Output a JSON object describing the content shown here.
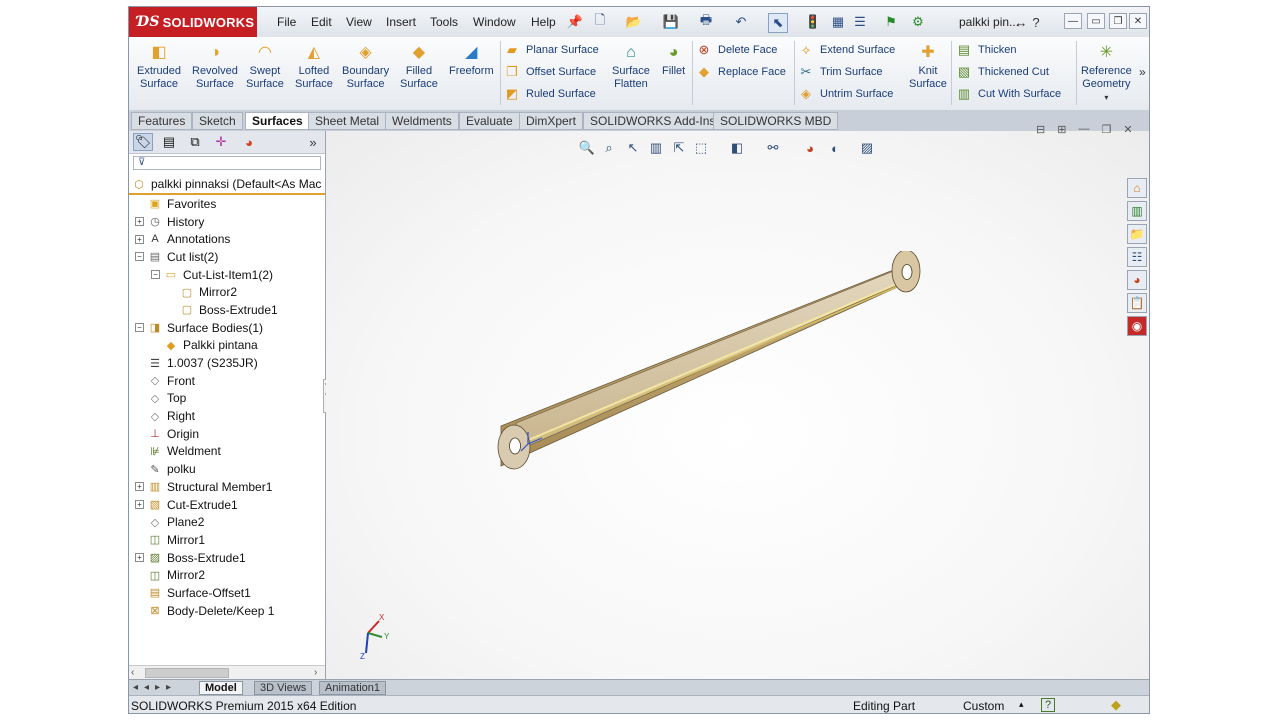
{
  "app": {
    "brand": "SOLIDWORKS",
    "document_title": "palkki pin...",
    "colors": {
      "brand_red": "#c51f24",
      "accent_orange": "#e0a030",
      "part_tan": "#d6bb86"
    }
  },
  "menu": [
    "File",
    "Edit",
    "View",
    "Insert",
    "Tools",
    "Window",
    "Help"
  ],
  "ribbon": {
    "large_buttons": [
      {
        "label_1": "Extruded",
        "label_2": "Surface",
        "icon": "extruded-surface-icon"
      },
      {
        "label_1": "Revolved",
        "label_2": "Surface",
        "icon": "revolved-surface-icon"
      },
      {
        "label_1": "Swept",
        "label_2": "Surface",
        "icon": "swept-surface-icon"
      },
      {
        "label_1": "Lofted",
        "label_2": "Surface",
        "icon": "lofted-surface-icon"
      },
      {
        "label_1": "Boundary",
        "label_2": "Surface",
        "icon": "boundary-surface-icon"
      },
      {
        "label_1": "Filled",
        "label_2": "Surface",
        "icon": "filled-surface-icon"
      },
      {
        "label_1": "Freeform",
        "label_2": "",
        "icon": "freeform-icon"
      }
    ],
    "col1": [
      "Planar Surface",
      "Offset Surface",
      "Ruled Surface"
    ],
    "surface_flatten": {
      "label_1": "Surface",
      "label_2": "Flatten"
    },
    "fillet": "Fillet",
    "col2": [
      "Delete Face",
      "Replace Face"
    ],
    "col3": [
      "Extend Surface",
      "Trim Surface",
      "Untrim Surface"
    ],
    "knit": {
      "label_1": "Knit",
      "label_2": "Surface"
    },
    "col4": [
      "Thicken",
      "Thickened Cut",
      "Cut With Surface"
    ],
    "reference_geometry": {
      "label_1": "Reference",
      "label_2": "Geometry"
    }
  },
  "tabs": [
    "Features",
    "Sketch",
    "Surfaces",
    "Sheet Metal",
    "Weldments",
    "Evaluate",
    "DimXpert",
    "SOLIDWORKS Add-Ins",
    "SOLIDWORKS MBD"
  ],
  "active_tab": "Surfaces",
  "tree": {
    "root": "palkki pinnaksi  (Default<As Mac",
    "items": [
      {
        "label": "Favorites",
        "expander": "",
        "indent": 0,
        "icon": "favorites-folder-icon"
      },
      {
        "label": "History",
        "expander": "+",
        "indent": 0,
        "icon": "history-icon"
      },
      {
        "label": "Annotations",
        "expander": "+",
        "indent": 0,
        "icon": "annotations-icon"
      },
      {
        "label": "Cut list(2)",
        "expander": "−",
        "indent": 0,
        "icon": "cut-list-icon"
      },
      {
        "label": "Cut-List-Item1(2)",
        "expander": "−",
        "indent": 1,
        "icon": "cut-list-item-folder-icon"
      },
      {
        "label": "Mirror2",
        "expander": "",
        "indent": 2,
        "icon": "solid-body-icon"
      },
      {
        "label": "Boss-Extrude1",
        "expander": "",
        "indent": 2,
        "icon": "solid-body-icon"
      },
      {
        "label": "Surface Bodies(1)",
        "expander": "−",
        "indent": 0,
        "icon": "surface-bodies-folder-icon"
      },
      {
        "label": "Palkki pintana",
        "expander": "",
        "indent": 1,
        "icon": "surface-body-icon"
      },
      {
        "label": "1.0037 (S235JR)",
        "expander": "",
        "indent": 0,
        "icon": "material-icon"
      },
      {
        "label": "Front",
        "expander": "",
        "indent": 0,
        "icon": "plane-icon"
      },
      {
        "label": "Top",
        "expander": "",
        "indent": 0,
        "icon": "plane-icon"
      },
      {
        "label": "Right",
        "expander": "",
        "indent": 0,
        "icon": "plane-icon"
      },
      {
        "label": "Origin",
        "expander": "",
        "indent": 0,
        "icon": "origin-icon"
      },
      {
        "label": "Weldment",
        "expander": "",
        "indent": 0,
        "icon": "weldment-icon"
      },
      {
        "label": "polku",
        "expander": "",
        "indent": 0,
        "icon": "sketch-icon"
      },
      {
        "label": "Structural Member1",
        "expander": "+",
        "indent": 0,
        "icon": "structural-member-icon"
      },
      {
        "label": "Cut-Extrude1",
        "expander": "+",
        "indent": 0,
        "icon": "cut-extrude-icon"
      },
      {
        "label": "Plane2",
        "expander": "",
        "indent": 0,
        "icon": "plane-icon"
      },
      {
        "label": "Mirror1",
        "expander": "",
        "indent": 0,
        "icon": "mirror-icon"
      },
      {
        "label": "Boss-Extrude1",
        "expander": "+",
        "indent": 0,
        "icon": "boss-extrude-icon"
      },
      {
        "label": "Mirror2",
        "expander": "",
        "indent": 0,
        "icon": "mirror-icon"
      },
      {
        "label": "Surface-Offset1",
        "expander": "",
        "indent": 0,
        "icon": "surface-offset-icon"
      },
      {
        "label": "Body-Delete/Keep 1",
        "expander": "",
        "indent": 0,
        "icon": "body-delete-icon"
      }
    ]
  },
  "bottom_tabs": [
    "Model",
    "3D Views",
    "Animation1"
  ],
  "status": {
    "edition": "SOLIDWORKS Premium 2015 x64 Edition",
    "mode": "Editing Part",
    "units": "Custom"
  },
  "triad": {
    "x": "X",
    "y": "Y",
    "z": "Z"
  }
}
